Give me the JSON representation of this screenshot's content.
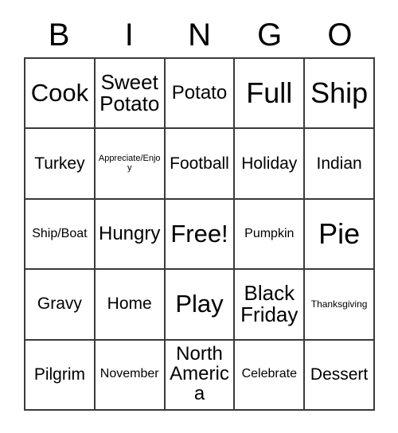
{
  "card": {
    "title": "BINGO",
    "header_letters": [
      "B",
      "I",
      "N",
      "G",
      "O"
    ],
    "border_color": "#3a3a3a",
    "background_color": "#ffffff",
    "text_color": "#000000",
    "free_space": "Free!",
    "rows": [
      [
        {
          "label": "Cook",
          "size": "fs-lg"
        },
        {
          "label": "Sweet Potato",
          "size": "fs-md"
        },
        {
          "label": "Potato",
          "size": "fs-sm"
        },
        {
          "label": "Full",
          "size": "fs-xl"
        },
        {
          "label": "Ship",
          "size": "fs-xl"
        }
      ],
      [
        {
          "label": "Turkey",
          "size": "fs-xs"
        },
        {
          "label": "Appreciate/Enjoy",
          "size": "fs-micro"
        },
        {
          "label": "Football",
          "size": "fs-xs"
        },
        {
          "label": "Holiday",
          "size": "fs-xs"
        },
        {
          "label": "Indian",
          "size": "fs-xs"
        }
      ],
      [
        {
          "label": "Ship/Boat",
          "size": "fs-xxs"
        },
        {
          "label": "Hungry",
          "size": "fs-sm"
        },
        {
          "label": "Free!",
          "size": "fs-lg"
        },
        {
          "label": "Pumpkin",
          "size": "fs-xxs"
        },
        {
          "label": "Pie",
          "size": "fs-xl"
        }
      ],
      [
        {
          "label": "Gravy",
          "size": "fs-xs"
        },
        {
          "label": "Home",
          "size": "fs-xs"
        },
        {
          "label": "Play",
          "size": "fs-lg"
        },
        {
          "label": "Black Friday",
          "size": "fs-md"
        },
        {
          "label": "Thanksgiving",
          "size": "fs-tiny"
        }
      ],
      [
        {
          "label": "Pilgrim",
          "size": "fs-xs"
        },
        {
          "label": "November",
          "size": "fs-xxs"
        },
        {
          "label": "North America",
          "size": "fs-sm"
        },
        {
          "label": "Celebrate",
          "size": "fs-xxs"
        },
        {
          "label": "Dessert",
          "size": "fs-xs"
        }
      ]
    ]
  }
}
